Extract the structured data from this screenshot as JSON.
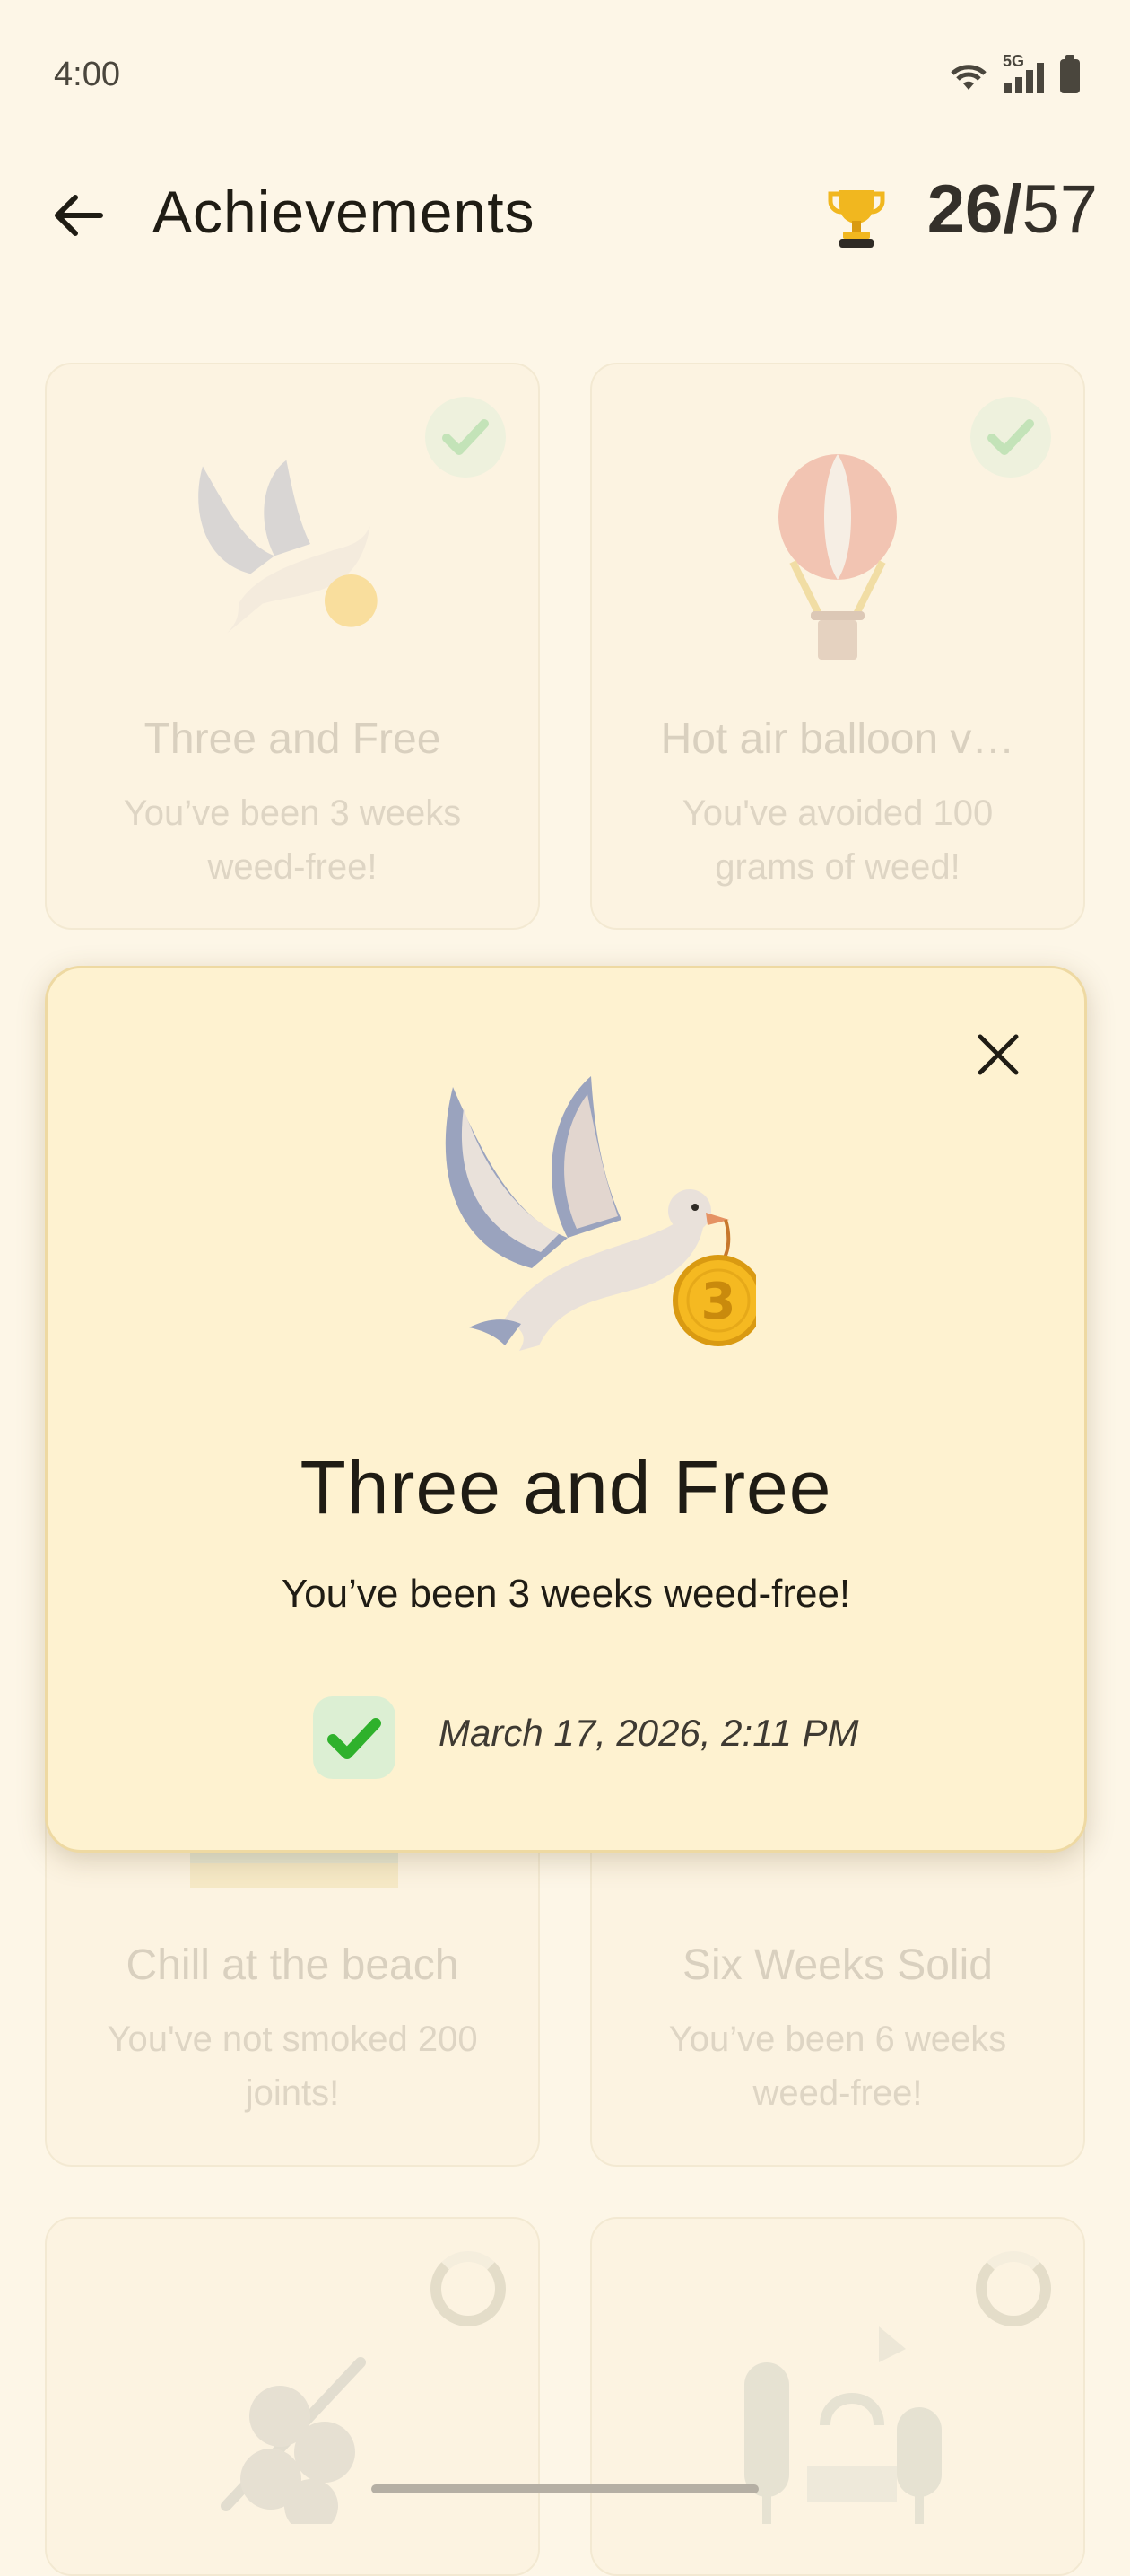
{
  "status_bar": {
    "time": "4:00",
    "network": "5G"
  },
  "header": {
    "title": "Achievements",
    "earned": "26",
    "separator": "/",
    "total": "57"
  },
  "cards": [
    {
      "title": "Three and Free",
      "description": "You’ve been 3 weeks weed-free!",
      "completed": true
    },
    {
      "title": "Hot air balloon v…",
      "description": "You've avoided 100 grams of weed!",
      "completed": true
    },
    {
      "title": "Chill at the beach",
      "description": "You've not smoked 200 joints!",
      "completed": true
    },
    {
      "title": "Six Weeks Solid",
      "description": "You’ve been 6 weeks weed-free!",
      "completed": true
    },
    {
      "title": "",
      "description": "",
      "completed": false
    },
    {
      "title": "",
      "description": "",
      "completed": false
    }
  ],
  "dialog": {
    "title": "Three and Free",
    "description": "You’ve been 3 weeks weed-free!",
    "medal_number": "3",
    "date": "March 17, 2026, 2:11 PM"
  },
  "colors": {
    "background": "#FDF6E7",
    "dialog_bg": "#FEF2D0",
    "check_green": "#2FB12C",
    "medal_gold": "#F5B921"
  }
}
